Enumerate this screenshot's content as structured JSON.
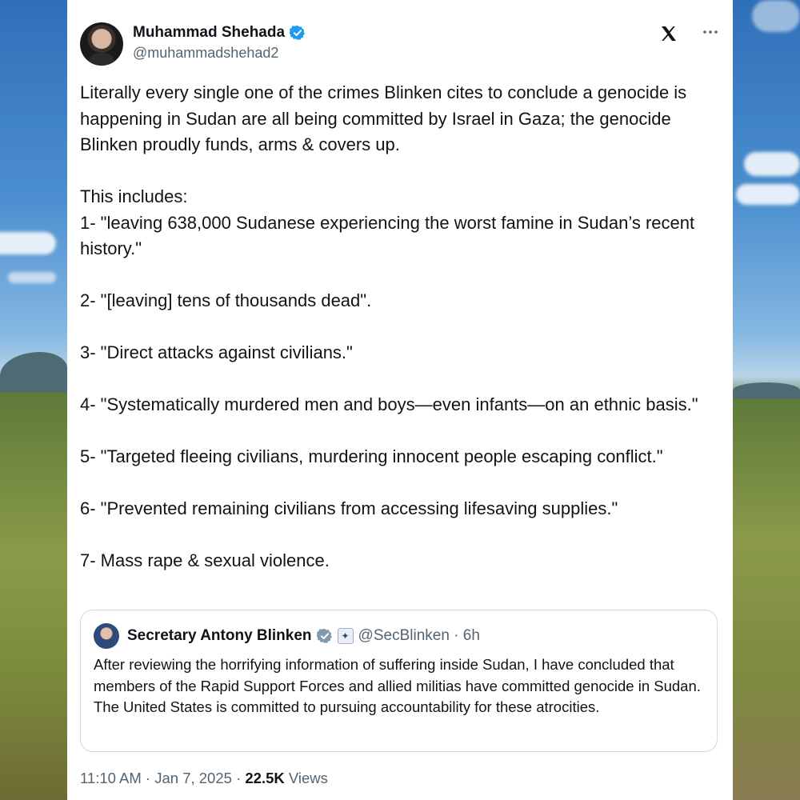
{
  "author": {
    "display_name": "Muhammad Shehada",
    "handle": "@muhammadshehad2",
    "icons": [
      "verified-badge-icon",
      "x-logo-icon",
      "more-icon"
    ]
  },
  "tweet": {
    "paragraphs": [
      "Literally every single one of the crimes Blinken cites to conclude a genocide is happening in Sudan are all being committed by Israel in Gaza; the genocide Blinken proudly funds, arms & covers up.",
      "This includes:",
      "1- \"leaving 638,000 Sudanese experiencing the worst famine in Sudan’s recent history.\"",
      "2- \"[leaving] tens of thousands dead\".",
      "3- \"Direct attacks against civilians.\"",
      "4- \"Systematically murdered men and boys—even infants—on an ethnic basis.\"",
      "5- \"Targeted fleeing civilians, murdering innocent people escaping conflict.\"",
      "6- \"Prevented remaining civilians from accessing lifesaving supplies.\"",
      "7- Mass rape & sexual violence."
    ]
  },
  "quoted": {
    "display_name": "Secretary Antony Blinken",
    "handle_time": "@SecBlinken · 6h",
    "text": "After reviewing the horrifying information of suffering inside Sudan, I have concluded that members of the Rapid Support Forces and allied militias have committed genocide in Sudan. The United States is committed to pursuing accountability for these atrocities."
  },
  "meta": {
    "timestamp": "11:10 AM · Jan 7, 2025 · ",
    "views_count": "22.5K",
    "views_label": " Views"
  },
  "colors": {
    "text": "#0f1419",
    "secondary": "#536471",
    "verified_blue": "#1d9bf0",
    "border": "#cfd9de"
  }
}
